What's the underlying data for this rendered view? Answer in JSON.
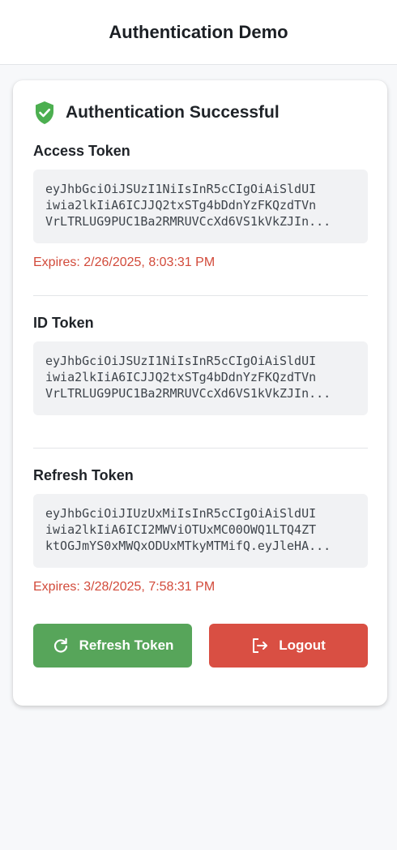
{
  "header": {
    "title": "Authentication Demo"
  },
  "status": {
    "icon": "shield-check-icon",
    "title": "Authentication Successful",
    "color": "#4caf50"
  },
  "tokens": {
    "access": {
      "label": "Access Token",
      "lines": [
        "eyJhbGciOiJSUzI1NiIsInR5cCIgOiAiSldUI",
        "iwia2lkIiA6ICJJQ2txSTg4bDdnYzFKQzdTVn",
        "VrLTRLUG9PUC1Ba2RMRUVCcXd6VS1kVkZJIn..."
      ],
      "expires": "Expires: 2/26/2025, 8:03:31 PM"
    },
    "id": {
      "label": "ID Token",
      "lines": [
        "eyJhbGciOiJSUzI1NiIsInR5cCIgOiAiSldUI",
        "iwia2lkIiA6ICJJQ2txSTg4bDdnYzFKQzdTVn",
        "VrLTRLUG9PUC1Ba2RMRUVCcXd6VS1kVkZJIn..."
      ]
    },
    "refresh": {
      "label": "Refresh Token",
      "lines": [
        "eyJhbGciOiJIUzUxMiIsInR5cCIgOiAiSldUI",
        "iwia2lkIiA6ICI2MWViOTUxMC00OWQ1LTQ4ZT",
        "ktOGJmYS0xMWQxODUxMTkyMTMifQ.eyJleHA..."
      ],
      "expires": "Expires: 3/28/2025, 7:58:31 PM"
    }
  },
  "buttons": {
    "refresh": {
      "label": "Refresh Token",
      "icon": "refresh-icon",
      "color": "#57a55a"
    },
    "logout": {
      "label": "Logout",
      "icon": "logout-icon",
      "color": "#d94f43"
    }
  }
}
